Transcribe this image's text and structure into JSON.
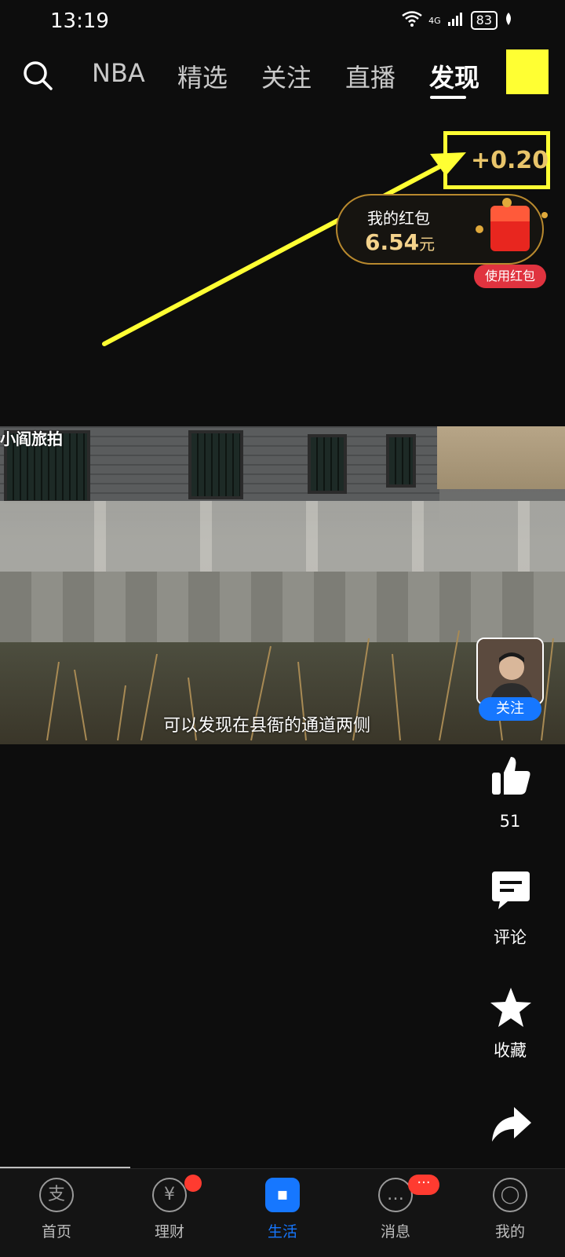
{
  "status": {
    "time": "13:19",
    "network": "4G",
    "battery": "83"
  },
  "nav": {
    "tabs": [
      {
        "label": "NBA"
      },
      {
        "label": "精选"
      },
      {
        "label": "关注"
      },
      {
        "label": "直播"
      },
      {
        "label": "发现"
      }
    ],
    "active_tab": "发现"
  },
  "reward": {
    "text": "+0.20"
  },
  "redpack": {
    "title": "我的红包",
    "amount": "6.54",
    "unit": "元",
    "button": "使用红包"
  },
  "video": {
    "watermark": "小阎旅拍",
    "subtitle": "可以发现在县衙的通道两侧"
  },
  "creator": {
    "follow_label": "关注"
  },
  "actions": {
    "like_count": "51",
    "comment_label": "评论",
    "favorite_label": "收藏"
  },
  "bottom_nav": [
    {
      "label": "首页",
      "icon": "alipay-icon"
    },
    {
      "label": "理财",
      "icon": "yuan-icon"
    },
    {
      "label": "生活",
      "icon": "life-icon"
    },
    {
      "label": "消息",
      "icon": "message-icon",
      "badge": "···"
    },
    {
      "label": "我的",
      "icon": "profile-icon"
    }
  ],
  "colors": {
    "accent": "#1677ff",
    "highlight": "#ffff33",
    "reward": "#e8c46a"
  }
}
